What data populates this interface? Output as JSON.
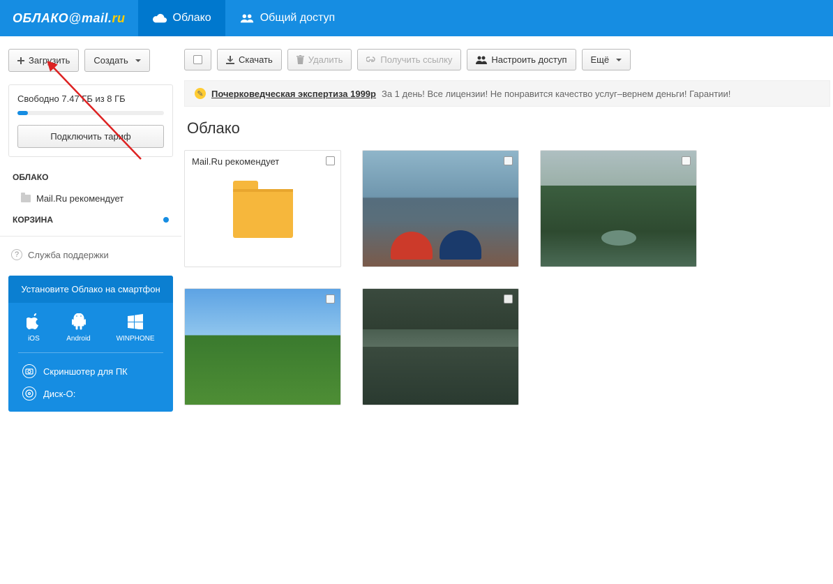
{
  "logo": {
    "text1": "ОБЛАКО",
    "at": "@",
    "text2": "mail",
    "dot": ".",
    "text3": "ru"
  },
  "nav": {
    "cloud": "Облако",
    "shared": "Общий доступ"
  },
  "sidebar": {
    "upload": "Загрузить",
    "create": "Создать",
    "storage_text": "Свободно 7.47 ГБ из 8 ГБ",
    "tariff": "Подключить тариф",
    "section_cloud": "ОБЛАКО",
    "recommends": "Mail.Ru рекомендует",
    "section_trash": "КОРЗИНА",
    "support": "Служба поддержки"
  },
  "promo": {
    "title": "Установите Облако на смартфон",
    "ios": "iOS",
    "android": "Android",
    "winphone": "WINPHONE",
    "screenshoter": "Скриншотер для ПК",
    "disko": "Диск-О:"
  },
  "toolbar": {
    "download": "Скачать",
    "delete": "Удалить",
    "getlink": "Получить ссылку",
    "access": "Настроить доступ",
    "more": "Ещё"
  },
  "ad": {
    "link": "Почерковедческая экспертиза 1999р",
    "text": "За 1 день! Все лицензии! Не понравится качество услуг–вернем деньги! Гарантии!"
  },
  "page_title": "Облако",
  "files": {
    "folder_label": "Mail.Ru рекомендует"
  }
}
